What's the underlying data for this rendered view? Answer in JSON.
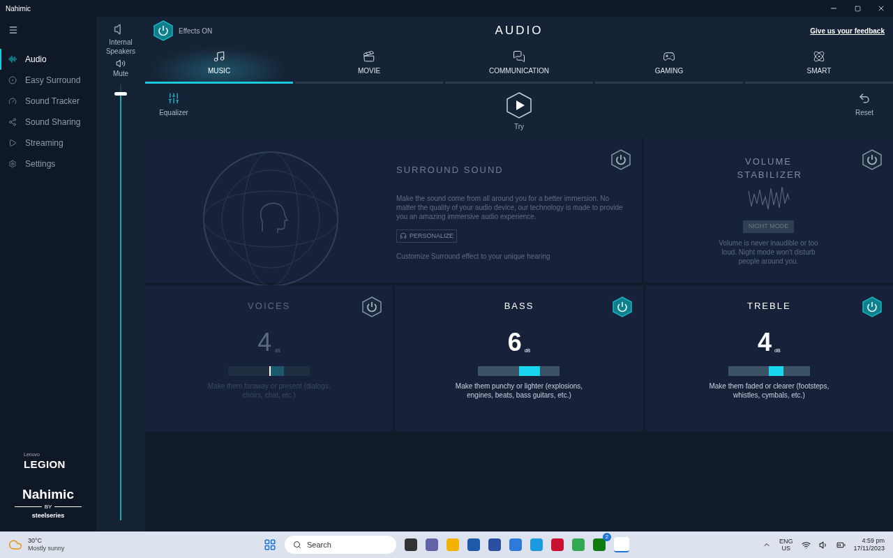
{
  "window": {
    "title": "Nahimic"
  },
  "sidebar": {
    "items": [
      {
        "label": "Audio",
        "selected": true
      },
      {
        "label": "Easy Surround",
        "selected": false
      },
      {
        "label": "Sound Tracker",
        "selected": false
      },
      {
        "label": "Sound Sharing",
        "selected": false
      },
      {
        "label": "Streaming",
        "selected": false
      },
      {
        "label": "Settings",
        "selected": false
      }
    ],
    "legion": {
      "small": "Lenovo",
      "big": "LEGION"
    },
    "nahimic": {
      "name": "Nahimic",
      "by": "BY",
      "brand": "steelseries"
    }
  },
  "device": {
    "name": "Internal Speakers",
    "mute": "Mute",
    "level": 0.98
  },
  "header": {
    "effects": {
      "label": "Effects ON",
      "on": true
    },
    "title": "AUDIO",
    "feedback": "Give us your feedback"
  },
  "tabs": [
    {
      "label": "MUSIC",
      "selected": true
    },
    {
      "label": "MOVIE",
      "selected": false
    },
    {
      "label": "COMMUNICATION",
      "selected": false
    },
    {
      "label": "GAMING",
      "selected": false
    },
    {
      "label": "SMART",
      "selected": false
    }
  ],
  "toolbar": {
    "equalizer": "Equalizer",
    "try": "Try",
    "reset": "Reset"
  },
  "surround": {
    "title": "SURROUND SOUND",
    "on": false,
    "text": "Make the sound come from all around you for a better immersion. No matter the quality of your audio device, our technology is made to provide you an amazing immersive audio experience.",
    "button": "PERSONALIZE",
    "note": "Customize Surround effect to your unique hearing"
  },
  "stabilizer": {
    "title": "VOLUME STABILIZER",
    "on": false,
    "button": "NIGHT MODE",
    "text": "Volume is never inaudible or too loud. Night mode won't disturb people around you."
  },
  "effects": [
    {
      "title": "VOICES",
      "on": false,
      "value": "4",
      "unit": "dB",
      "level": 0.68,
      "text": "Make them faraway or present (dialogs, choirs, chat, etc.)"
    },
    {
      "title": "BASS",
      "on": true,
      "value": "6",
      "unit": "dB",
      "level": 0.76,
      "text": "Make them punchy or lighter (explosions, engines, beats, bass guitars, etc.)"
    },
    {
      "title": "TREBLE",
      "on": true,
      "value": "4",
      "unit": "dB",
      "level": 0.68,
      "text": "Make them faded or clearer (footsteps, whistles, cymbals, etc.)"
    }
  ],
  "taskbar": {
    "temp": "30°C",
    "weather": "Mostly sunny",
    "search": "Search",
    "badge": "2",
    "lang": "ENG",
    "region": "US",
    "time": "4:59 pm",
    "date": "17/11/2023"
  }
}
